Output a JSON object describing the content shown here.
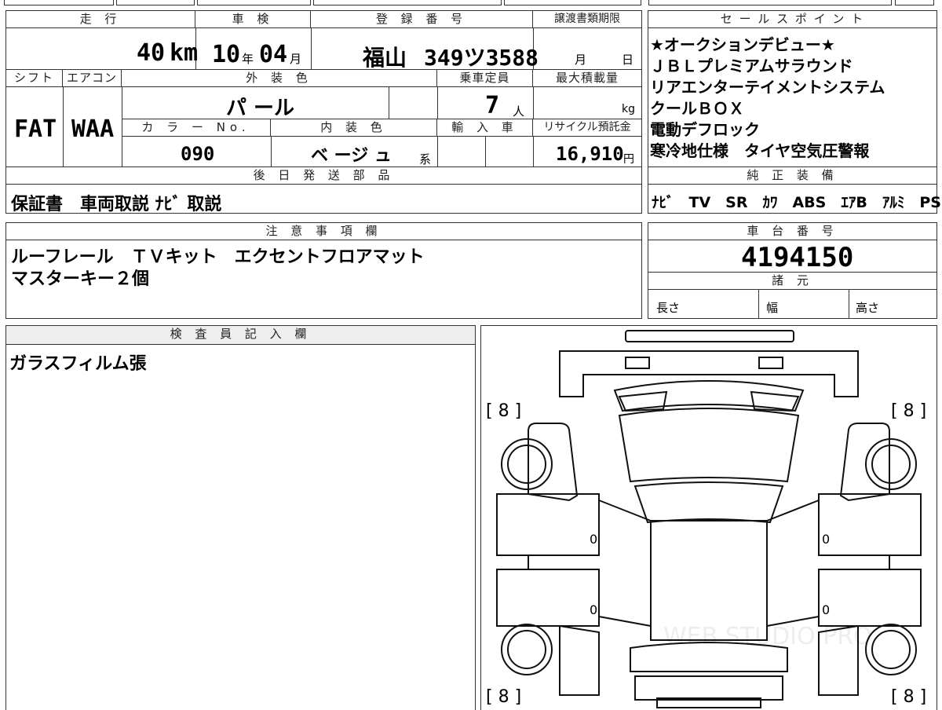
{
  "headers": {
    "mileage": "走 行",
    "inspection": "車 検",
    "registration": "登 録 番 号",
    "transfer_deadline": "譲渡書類期限",
    "sales_points": "セ ー ル ス ポ イ ン ト",
    "shift": "シフト",
    "aircon": "エアコン",
    "exterior_color": "外 装 色",
    "capacity": "乗車定員",
    "max_load": "最大積載量",
    "color_no": "カ ラ ー No.",
    "interior_color": "内 装 色",
    "import": "輸 入 車",
    "recycle": "リサイクル預託金",
    "later_parts": "後 日 発 送 部 品",
    "genuine_equipment": "純 正 装 備",
    "notes": "注 意 事 項 欄",
    "chassis_no": "車 台 番 号",
    "specs": "諸 元",
    "inspector": "検 査 員 記 入 欄"
  },
  "vehicle": {
    "mileage_value": "40",
    "mileage_unit": "km",
    "inspection_year": "10",
    "inspection_year_unit": "年",
    "inspection_month": "04",
    "inspection_month_unit": "月",
    "plate_region": "福山",
    "plate_number": "349ツ3588",
    "deadline_month_unit": "月",
    "deadline_day_unit": "日",
    "shift": "FAT",
    "aircon": "WAA",
    "exterior_color": "パ ール",
    "capacity": "7",
    "capacity_unit": "人",
    "max_load_unit": "kg",
    "color_no": "090",
    "interior_color": "ベ ージ ュ",
    "interior_suffix": "系",
    "recycle_fee": "16,910",
    "recycle_unit": "円",
    "chassis_no": "4194150",
    "length_label": "長さ",
    "width_label": "幅",
    "height_label": "高さ"
  },
  "sales_points": [
    "★オークションデビュー★",
    "ＪＢＬプレミアムサラウンド",
    "リアエンターテイメントシステム",
    "クールＢＯＸ",
    "電動デフロック",
    "寒冷地仕様　タイヤ空気圧警報"
  ],
  "later_parts": "保証書　車両取説 ﾅﾋﾞ 取説",
  "genuine_equipment": "ﾅﾋﾞ　TV　SR　ｶﾜ　ABS　ｴｱB　ｱﾙﾐ　PS　PW",
  "notes": [
    "ルーフレール　ＴＶキット　エクセントフロアマット",
    "マスターキー２個"
  ],
  "inspector_note": "ガラスフィルム張",
  "diagram": {
    "tire_front_left": "[ 8 ]",
    "tire_front_right": "[ 8 ]",
    "tire_rear_left": "[ 8 ]",
    "tire_rear_right": "[ 8 ]",
    "door_fl": "0",
    "door_fr": "0",
    "door_rl": "0",
    "door_rr": "0",
    "watermark": "WEB STUDIO PRO"
  }
}
